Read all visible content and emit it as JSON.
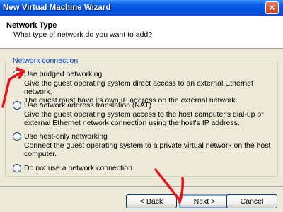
{
  "window": {
    "title": "New Virtual Machine Wizard",
    "close_glyph": "✕"
  },
  "header": {
    "title": "Network Type",
    "subtitle": "What type of network do you want to add?"
  },
  "group": {
    "label": "Network connection"
  },
  "options": [
    {
      "label": "Use bridged networking",
      "checked": true,
      "desc": [
        "Give the guest operating system direct access to an external Ethernet network.",
        "The guest must have its own IP address on the external network."
      ]
    },
    {
      "label": "Use network address translation (NAT)",
      "checked": false,
      "desc": [
        "Give the guest operating system access to the host computer's dial-up or",
        "external Ethernet network connection using the host's IP address."
      ]
    },
    {
      "label": "Use host-only networking",
      "checked": false,
      "desc": [
        "Connect the guest operating system to a private virtual network on the host",
        "computer."
      ]
    },
    {
      "label": "Do not use a network connection",
      "checked": false,
      "desc": []
    }
  ],
  "buttons": {
    "back": "< Back",
    "next": "Next >",
    "cancel": "Cancel"
  },
  "colors": {
    "annotation": "#e8141a",
    "group_label": "#0046d5"
  }
}
